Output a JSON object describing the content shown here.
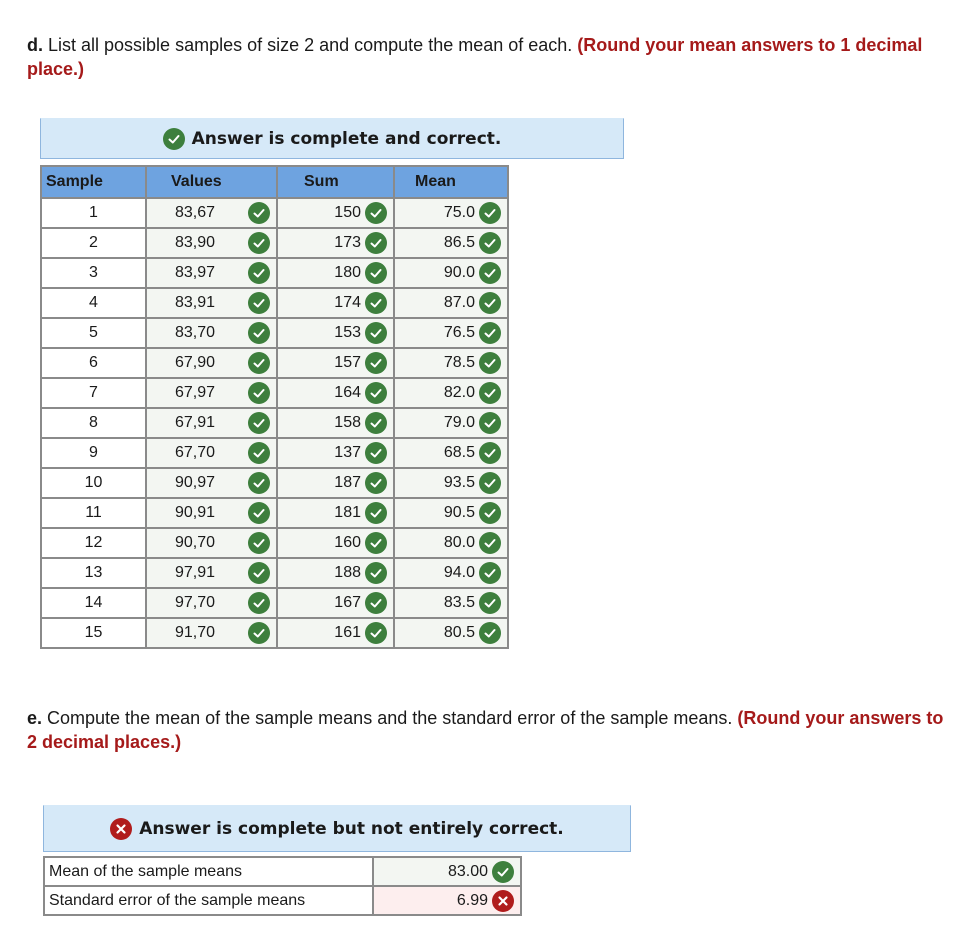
{
  "part_d": {
    "label": "d.",
    "question": " List all possible samples of size 2 and compute the mean of each. ",
    "hint": "(Round your mean answers to 1 decimal place.)",
    "banner": {
      "icon": "check-circle-icon",
      "status": "correct",
      "text": "Answer is complete and correct."
    },
    "table": {
      "headers": [
        "Sample",
        "Values",
        "Sum",
        "Mean"
      ],
      "rows": [
        {
          "sample": "1",
          "values": "83,67",
          "sum": "150",
          "mean": "75.0",
          "status": "correct"
        },
        {
          "sample": "2",
          "values": "83,90",
          "sum": "173",
          "mean": "86.5",
          "status": "correct"
        },
        {
          "sample": "3",
          "values": "83,97",
          "sum": "180",
          "mean": "90.0",
          "status": "correct"
        },
        {
          "sample": "4",
          "values": "83,91",
          "sum": "174",
          "mean": "87.0",
          "status": "correct"
        },
        {
          "sample": "5",
          "values": "83,70",
          "sum": "153",
          "mean": "76.5",
          "status": "correct"
        },
        {
          "sample": "6",
          "values": "67,90",
          "sum": "157",
          "mean": "78.5",
          "status": "correct"
        },
        {
          "sample": "7",
          "values": "67,97",
          "sum": "164",
          "mean": "82.0",
          "status": "correct"
        },
        {
          "sample": "8",
          "values": "67,91",
          "sum": "158",
          "mean": "79.0",
          "status": "correct"
        },
        {
          "sample": "9",
          "values": "67,70",
          "sum": "137",
          "mean": "68.5",
          "status": "correct"
        },
        {
          "sample": "10",
          "values": "90,97",
          "sum": "187",
          "mean": "93.5",
          "status": "correct"
        },
        {
          "sample": "11",
          "values": "90,91",
          "sum": "181",
          "mean": "90.5",
          "status": "correct"
        },
        {
          "sample": "12",
          "values": "90,70",
          "sum": "160",
          "mean": "80.0",
          "status": "correct"
        },
        {
          "sample": "13",
          "values": "97,91",
          "sum": "188",
          "mean": "94.0",
          "status": "correct"
        },
        {
          "sample": "14",
          "values": "97,70",
          "sum": "167",
          "mean": "83.5",
          "status": "correct"
        },
        {
          "sample": "15",
          "values": "91,70",
          "sum": "161",
          "mean": "80.5",
          "status": "correct"
        }
      ]
    }
  },
  "part_e": {
    "label": "e.",
    "question": " Compute the mean of the sample means and the standard error of the sample means. ",
    "hint": "(Round your answers to 2 decimal places.)",
    "banner": {
      "icon": "x-circle-icon",
      "status": "incorrect",
      "text": "Answer is complete but not entirely correct."
    },
    "rows": [
      {
        "label": "Mean of the sample means",
        "value": "83.00",
        "status": "correct"
      },
      {
        "label": "Standard error of the sample means",
        "value": "6.99",
        "status": "incorrect"
      }
    ]
  },
  "colors": {
    "correct": "#3d7f3d",
    "incorrect": "#b01c1c",
    "hint_text": "#a51a1a",
    "banner_bg": "#d6e9f8",
    "header_bg": "#6ea3e0",
    "correct_cell_bg": "#f3f6f2",
    "incorrect_cell_bg": "#fdeeee"
  }
}
